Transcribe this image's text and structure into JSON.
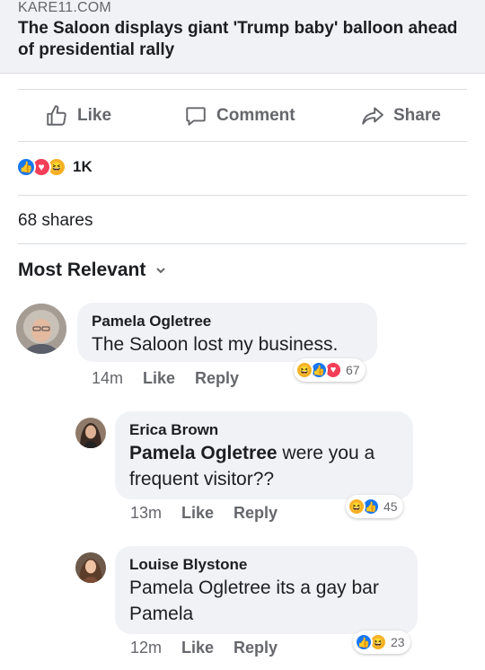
{
  "post": {
    "source": "KARE11.COM",
    "title": "The Saloon displays giant 'Trump baby' balloon ahead of presidential rally"
  },
  "actions": {
    "like": "Like",
    "comment": "Comment",
    "share": "Share"
  },
  "reactions": {
    "icons": [
      "like-icon",
      "love-icon",
      "haha-icon"
    ],
    "count": "1K"
  },
  "shares": "68 shares",
  "sort": {
    "label": "Most Relevant"
  },
  "comments": [
    {
      "name": "Pamela Ogletree",
      "text": "The Saloon lost my business.",
      "time": "14m",
      "like": "Like",
      "reply": "Reply",
      "reaction_icons": [
        "haha-icon",
        "like-icon",
        "love-icon"
      ],
      "reaction_count": "67"
    },
    {
      "name": "Erica Brown",
      "mention": "Pamela Ogletree",
      "text": " were you a frequent visitor??",
      "time": "13m",
      "like": "Like",
      "reply": "Reply",
      "reaction_icons": [
        "haha-icon",
        "like-icon"
      ],
      "reaction_count": "45"
    },
    {
      "name": "Louise Blystone",
      "text": "Pamela Ogletree its a gay bar Pamela",
      "time": "12m",
      "like": "Like",
      "reply": "Reply",
      "reaction_icons": [
        "like-icon",
        "haha-icon"
      ],
      "reaction_count": "23"
    }
  ],
  "colors": {
    "like_blue": "#1877f2",
    "love_red": "#f33e58",
    "haha_yellow": "#f7b125",
    "secondary_text": "#65676b",
    "bubble_bg": "#f0f2f5"
  }
}
